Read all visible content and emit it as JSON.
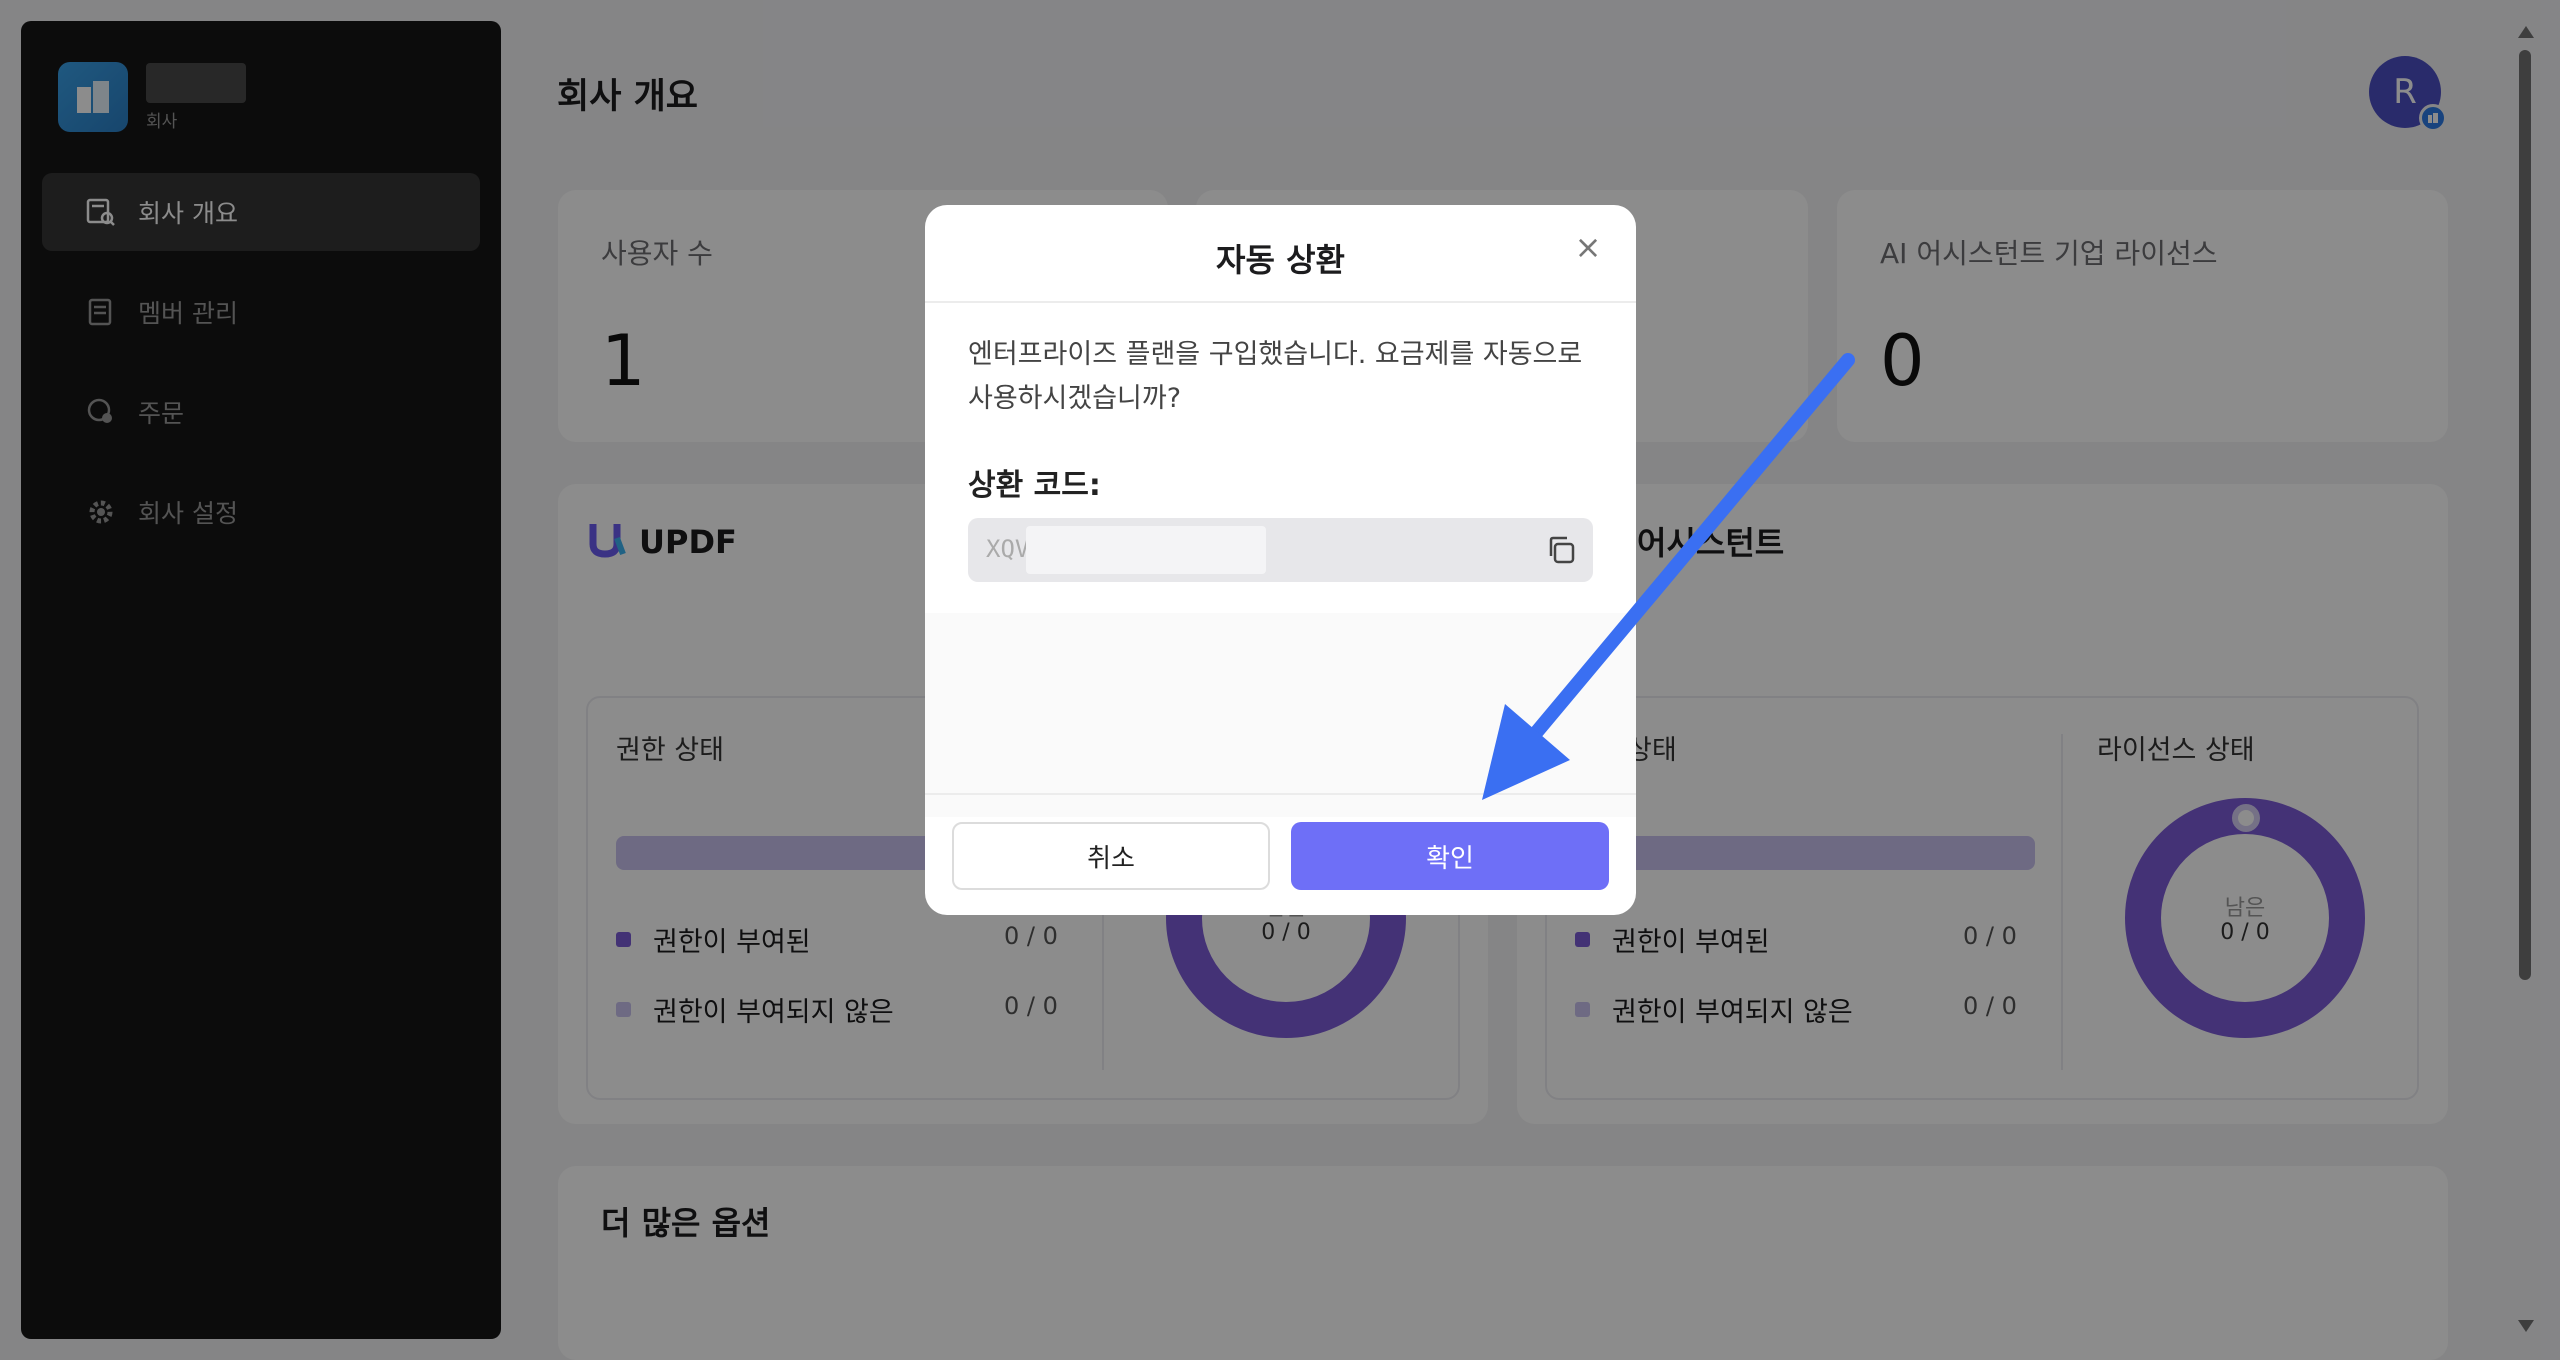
{
  "sidebar": {
    "brand_sub": "회사",
    "items": [
      {
        "label": "회사 개요",
        "icon": "overview-icon",
        "active": true
      },
      {
        "label": "멤버 관리",
        "icon": "members-icon",
        "active": false
      },
      {
        "label": "주문",
        "icon": "orders-icon",
        "active": false
      },
      {
        "label": "회사 설정",
        "icon": "gear-icon",
        "active": false
      }
    ]
  },
  "header": {
    "title": "회사 개요",
    "avatar_letter": "R"
  },
  "stats": {
    "users": {
      "label": "사용자 수",
      "value": "1"
    },
    "ai_license": {
      "label": "AI 어시스턴트 기업 라이선스",
      "value": "0"
    }
  },
  "updf": {
    "title": "UPDF",
    "permission_label": "권한 상태",
    "granted": "권한이 부여된",
    "granted_val": "0 / 0",
    "not_granted": "권한이 부여되지 않은",
    "not_granted_val": "0 / 0",
    "donut_label": "남은",
    "donut_value": "0 / 0"
  },
  "ai": {
    "title": "어시스턴트",
    "permission_label": "상태",
    "license_label": "라이선스 상태",
    "granted": "권한이 부여된",
    "granted_val": "0 / 0",
    "not_granted": "권한이 부여되지 않은",
    "not_granted_val": "0 / 0",
    "donut_label": "남은",
    "donut_value": "0 / 0"
  },
  "more": {
    "title": "더 많은 옵션"
  },
  "modal": {
    "title": "자동 상환",
    "message": "엔터프라이즈 플랜을 구입했습니다. 요금제를 자동으로 사용하시겠습니까?",
    "code_label": "상환 코드:",
    "code_value": "XQV",
    "cancel": "취소",
    "confirm": "확인",
    "close": "×"
  },
  "colors": {
    "accent": "#6e6ff7",
    "donut": "#7d5bd8",
    "granted": "#7b5bd6",
    "not_granted": "#c9c2ef"
  }
}
